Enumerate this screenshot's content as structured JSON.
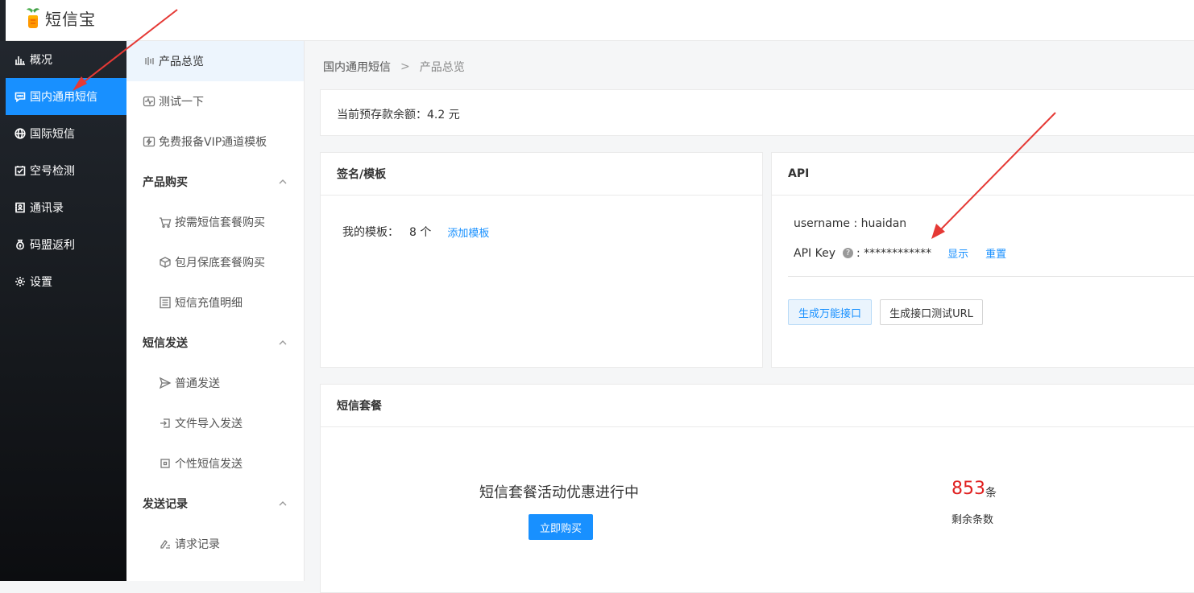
{
  "app": {
    "name": "短信宝"
  },
  "sidebar": {
    "items": [
      {
        "label": "概况",
        "icon": "bar-chart-icon",
        "active": false
      },
      {
        "label": "国内通用短信",
        "icon": "message-icon",
        "active": true
      },
      {
        "label": "国际短信",
        "icon": "globe-icon",
        "active": false
      },
      {
        "label": "空号检测",
        "icon": "check-square-icon",
        "active": false
      },
      {
        "label": "通讯录",
        "icon": "contacts-icon",
        "active": false
      },
      {
        "label": "码盟返利",
        "icon": "money-bag-icon",
        "active": false
      },
      {
        "label": "设置",
        "icon": "gear-icon",
        "active": false
      }
    ]
  },
  "subnav": {
    "overview": "产品总览",
    "test": "测试一下",
    "vip_template": "免费报备VIP通道模板",
    "purchase_group": "产品购买",
    "purchase_items": [
      "按需短信套餐购买",
      "包月保底套餐购买",
      "短信充值明细"
    ],
    "send_group": "短信发送",
    "send_items": [
      "普通发送",
      "文件导入发送",
      "个性短信发送"
    ],
    "record_group": "发送记录",
    "record_items": [
      "请求记录"
    ]
  },
  "breadcrumb": {
    "parent": "国内通用短信",
    "separator": ">",
    "current": "产品总览"
  },
  "balance": {
    "text": "当前预存款余额：4.2 元"
  },
  "sign_card": {
    "title": "签名/模板",
    "my_template_label": "我的模板：",
    "count": "8 个",
    "add_link": "添加模板"
  },
  "api_card": {
    "title": "API",
    "username_text": "username : huaidan",
    "apikey_label": "API Key",
    "help": "?",
    "apikey_value": ": ************",
    "show_link": "显示",
    "reset_link": "重置",
    "btn_generate": "生成万能接口",
    "btn_test_url": "生成接口测试URL"
  },
  "package_card": {
    "title": "短信套餐",
    "promo_text": "短信套餐活动优惠进行中",
    "buy_button": "立即购买",
    "remaining_count": "853",
    "unit": "条",
    "remaining_label": "剩余条数"
  },
  "colors": {
    "accent": "#1890ff",
    "sidebar_bg": "#1f2329",
    "highlight_red": "#e02020",
    "annotation_arrow": "#e53935"
  }
}
